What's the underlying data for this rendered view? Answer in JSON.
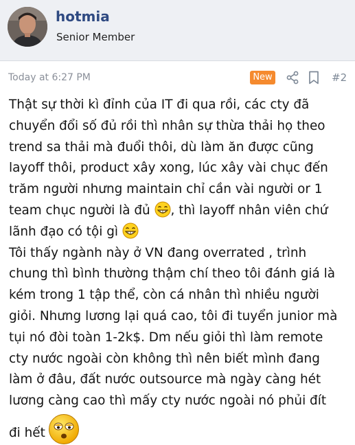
{
  "author": {
    "name": "hotmia",
    "title": "Senior Member"
  },
  "meta": {
    "time": "Today at 6:27 PM",
    "badge": "New",
    "post_number": "#2"
  },
  "body": {
    "lines": [
      "Thật sự thời kì đỉnh của IT đi qua rồi, các cty đã",
      "chuyển đổi số đủ rồi thì nhân sự thừa thải họ theo",
      "trend sa thải mà đuổi thôi, dù làm ăn được cũng",
      "layoff thôi, product xây xong, lúc xây vài chục đến",
      "trăm người nhưng maintain chỉ cần vài người or 1",
      "team chục người là đủ",
      ", thì layoff nhân viên chứ",
      "lãnh đạo có tội gì",
      "Tôi thấy ngành này ở VN đang overrated , trình",
      "chung thì bình thường thậm chí theo tôi đánh giá là",
      "kém trong 1 tập thể, còn cá nhân thì nhiều người",
      "giỏi. Nhưng lương lại quá cao, tôi đi tuyển junior mà",
      "tụi nó đòi toàn 1-2k$. Dm nếu giỏi thì làm remote",
      "cty nước ngoài còn không thì nên biết mình đang",
      "làm ở đâu, đất nước outsource mà ngày càng hét",
      "lương càng cao thì mấy cty nước ngoài nó phủi đít",
      "đi hết"
    ]
  },
  "icons": {
    "share": "share-icon",
    "bookmark": "bookmark-icon",
    "grin": "grin-smiley-icon",
    "dizzy": "dizzy-smiley-icon"
  },
  "colors": {
    "username": "#2f4a82",
    "badge": "#f58a2e",
    "header_bg": "#eef0f4"
  }
}
